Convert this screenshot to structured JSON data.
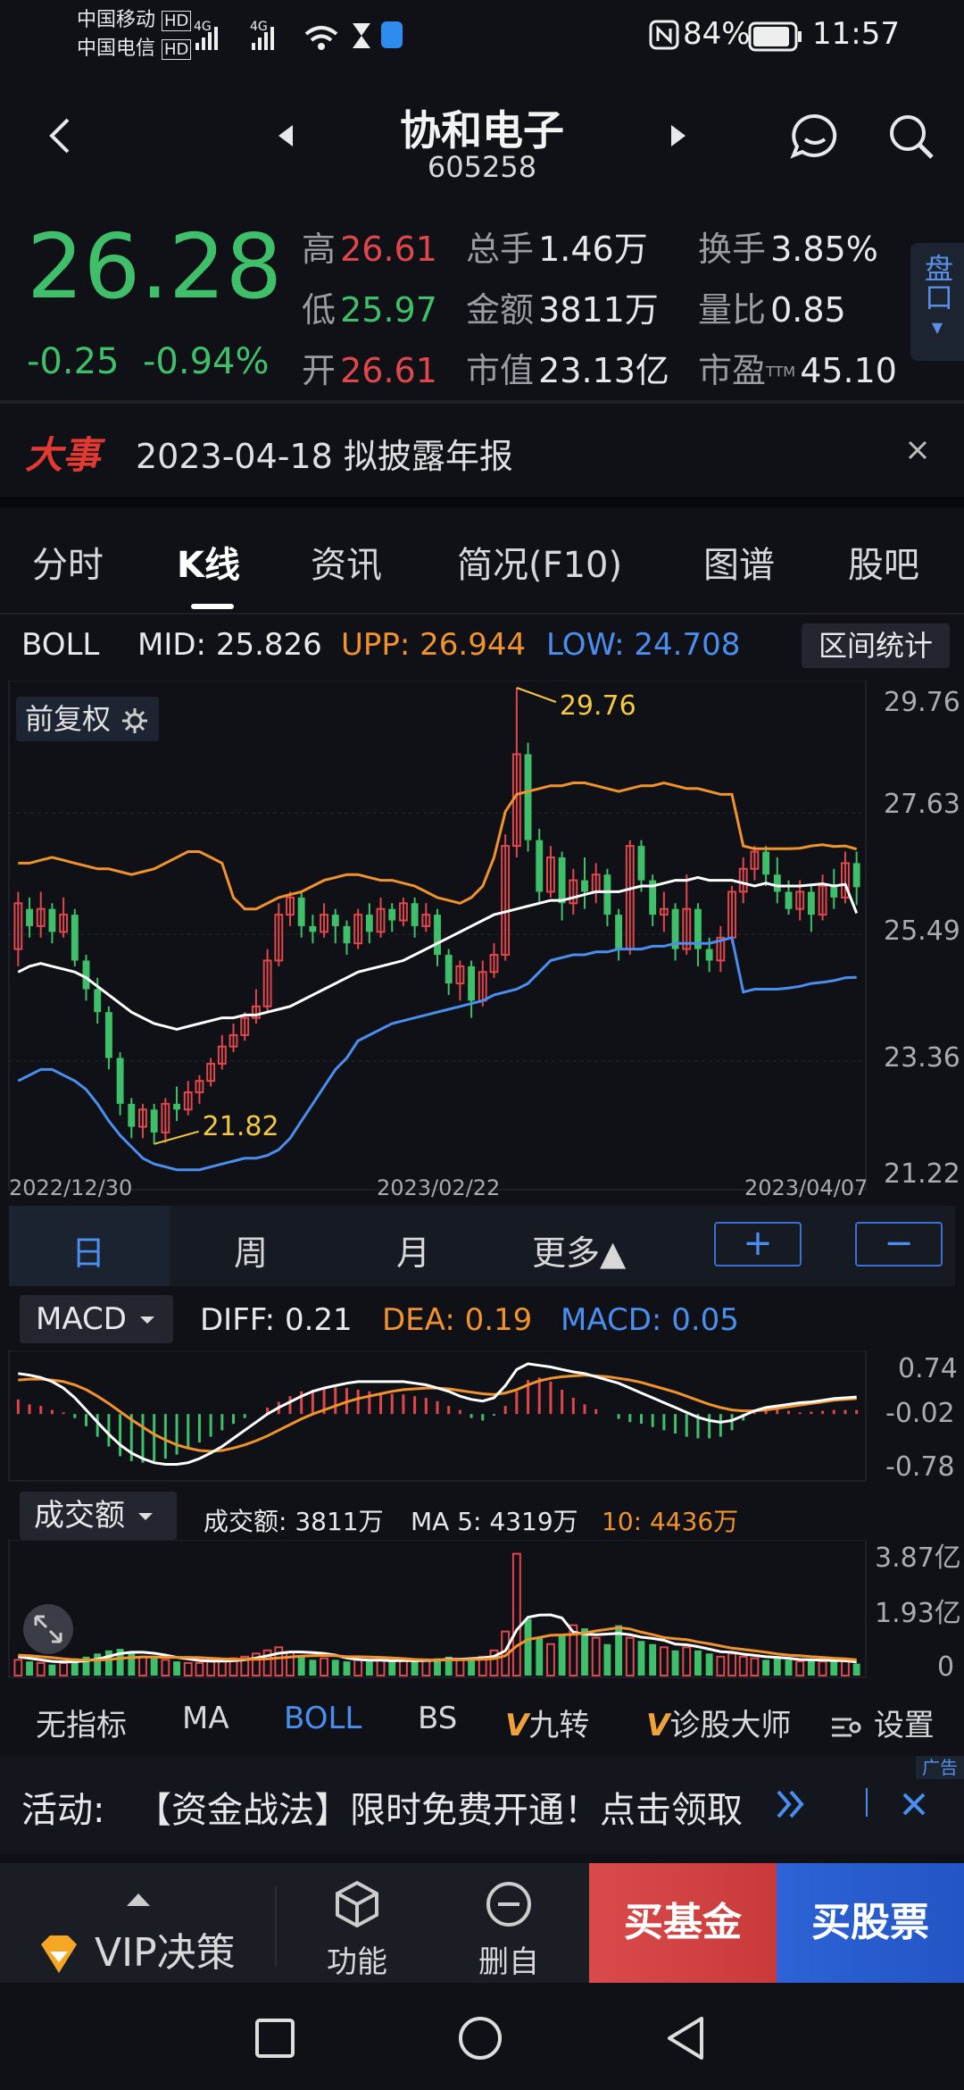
{
  "status_bar": {
    "carrier1": "中国移动",
    "carrier2": "中国电信",
    "hd": "HD",
    "signal_4g": "4G",
    "battery": "84%",
    "time": "11:57"
  },
  "header": {
    "title": "协和电子",
    "code": "605258"
  },
  "quote": {
    "price": "26.28",
    "change": "-0.25",
    "change_pct": "-0.94%",
    "high_label": "高",
    "high": "26.61",
    "low_label": "低",
    "low": "25.97",
    "open_label": "开",
    "open": "26.61",
    "volume_label": "总手",
    "volume": "1.46万",
    "amount_label": "金额",
    "amount": "3811万",
    "mktcap_label": "市值",
    "mktcap": "23.13亿",
    "turnover_label": "换手",
    "turnover": "3.85%",
    "vol_ratio_label": "量比",
    "vol_ratio": "0.85",
    "pe_label": "市盈",
    "pe_sup": "TTM",
    "pe": "45.10",
    "pankou": "盘口"
  },
  "news": {
    "tag": "大事",
    "text": "2023-04-18 拟披露年报"
  },
  "tabs": [
    "分时",
    "K线",
    "资讯",
    "简况(F10)",
    "图谱",
    "股吧"
  ],
  "boll": {
    "name": "BOLL",
    "mid_label": "MID:",
    "mid": "25.826",
    "upp_label": "UPP:",
    "upp": "26.944",
    "low_label": "LOW:",
    "low": "24.708",
    "range_stats": "区间统计",
    "adjust": "前复权"
  },
  "colors": {
    "up": "#e0474c",
    "down": "#3fbf6a",
    "upper_band": "#f0922e",
    "mid_band": "#ffffff",
    "lower_band": "#4a8ff0",
    "label_yellow": "#f5c842"
  },
  "chart_data": [
    {
      "type": "candlestick",
      "title": "",
      "x_labels": [
        "2022/12/30",
        "2023/02/22",
        "2023/04/07"
      ],
      "ylim": [
        21.22,
        29.76
      ],
      "y_ticks": [
        "29.76",
        "27.63",
        "25.49",
        "23.36",
        "21.22"
      ],
      "annotations": [
        {
          "label": "29.76",
          "value": 29.76
        },
        {
          "label": "21.82",
          "value": 21.82
        }
      ],
      "candles": [
        [
          25.2,
          26.0,
          24.9,
          26.2
        ],
        [
          25.9,
          25.6,
          25.4,
          26.1
        ],
        [
          25.6,
          25.9,
          25.4,
          26.2
        ],
        [
          25.9,
          25.5,
          25.3,
          26.0
        ],
        [
          25.5,
          25.8,
          25.4,
          26.1
        ],
        [
          25.8,
          25.0,
          24.9,
          25.9
        ],
        [
          25.0,
          24.5,
          24.3,
          25.1
        ],
        [
          24.5,
          24.1,
          23.9,
          24.7
        ],
        [
          24.1,
          23.3,
          23.1,
          24.2
        ],
        [
          23.3,
          22.5,
          22.3,
          23.4
        ],
        [
          22.5,
          22.1,
          21.9,
          22.6
        ],
        [
          22.1,
          22.4,
          21.9,
          22.5
        ],
        [
          22.4,
          22.0,
          21.8,
          22.5
        ],
        [
          22.0,
          22.5,
          21.82,
          22.6
        ],
        [
          22.5,
          22.4,
          22.2,
          22.8
        ],
        [
          22.4,
          22.7,
          22.3,
          22.9
        ],
        [
          22.7,
          22.9,
          22.5,
          23.0
        ],
        [
          22.9,
          23.2,
          22.8,
          23.3
        ],
        [
          23.2,
          23.5,
          23.1,
          23.7
        ],
        [
          23.5,
          23.7,
          23.4,
          23.9
        ],
        [
          23.7,
          24.0,
          23.6,
          24.1
        ],
        [
          24.0,
          24.2,
          23.9,
          24.5
        ],
        [
          24.2,
          25.0,
          24.1,
          25.2
        ],
        [
          25.0,
          25.8,
          24.9,
          26.0
        ],
        [
          25.8,
          26.1,
          25.6,
          26.2
        ],
        [
          26.1,
          25.6,
          25.4,
          26.2
        ],
        [
          25.6,
          25.5,
          25.3,
          25.8
        ],
        [
          25.5,
          25.8,
          25.4,
          26.0
        ],
        [
          25.8,
          25.6,
          25.3,
          25.9
        ],
        [
          25.6,
          25.3,
          25.1,
          25.7
        ],
        [
          25.3,
          25.8,
          25.2,
          25.9
        ],
        [
          25.8,
          25.5,
          25.3,
          26.0
        ],
        [
          25.5,
          25.9,
          25.4,
          26.1
        ],
        [
          25.9,
          25.7,
          25.5,
          26.0
        ],
        [
          25.7,
          26.0,
          25.6,
          26.1
        ],
        [
          26.0,
          25.6,
          25.4,
          26.1
        ],
        [
          25.6,
          25.8,
          25.5,
          26.0
        ],
        [
          25.8,
          25.1,
          24.9,
          25.9
        ],
        [
          25.1,
          24.6,
          24.4,
          25.2
        ],
        [
          24.6,
          24.9,
          24.3,
          25.0
        ],
        [
          24.9,
          24.3,
          24.0,
          25.0
        ],
        [
          24.3,
          24.8,
          24.2,
          25.0
        ],
        [
          24.8,
          25.1,
          24.7,
          25.3
        ],
        [
          25.1,
          27.0,
          25.0,
          27.2
        ],
        [
          27.0,
          28.6,
          26.8,
          29.76
        ],
        [
          28.6,
          27.1,
          26.9,
          28.8
        ],
        [
          27.1,
          26.2,
          26.0,
          27.3
        ],
        [
          26.2,
          26.8,
          26.1,
          27.0
        ],
        [
          26.8,
          26.0,
          25.7,
          26.9
        ],
        [
          26.0,
          26.4,
          25.8,
          26.6
        ],
        [
          26.4,
          26.2,
          25.9,
          26.8
        ],
        [
          26.2,
          26.5,
          26.0,
          26.7
        ],
        [
          26.5,
          25.8,
          25.6,
          26.6
        ],
        [
          25.8,
          25.2,
          25.0,
          25.9
        ],
        [
          25.2,
          27.0,
          25.1,
          27.1
        ],
        [
          27.0,
          26.4,
          26.2,
          27.1
        ],
        [
          26.4,
          25.8,
          25.6,
          26.5
        ],
        [
          25.8,
          25.9,
          25.5,
          26.2
        ],
        [
          25.9,
          25.2,
          25.0,
          26.0
        ],
        [
          25.2,
          25.9,
          25.1,
          26.5
        ],
        [
          25.9,
          25.2,
          24.9,
          26.0
        ],
        [
          25.2,
          25.0,
          24.8,
          25.4
        ],
        [
          25.0,
          25.4,
          24.8,
          25.6
        ],
        [
          25.4,
          26.2,
          25.3,
          26.3
        ],
        [
          26.2,
          26.6,
          26.0,
          26.8
        ],
        [
          26.6,
          26.9,
          26.4,
          27.0
        ],
        [
          26.9,
          26.5,
          26.3,
          27.0
        ],
        [
          26.5,
          26.2,
          26.0,
          26.8
        ],
        [
          26.2,
          25.9,
          25.8,
          26.4
        ],
        [
          25.9,
          26.2,
          25.7,
          26.4
        ],
        [
          26.2,
          25.8,
          25.5,
          26.3
        ],
        [
          25.8,
          26.3,
          25.7,
          26.5
        ],
        [
          26.3,
          26.1,
          25.9,
          26.6
        ],
        [
          26.1,
          26.7,
          26.0,
          26.9
        ],
        [
          26.7,
          26.28,
          25.97,
          26.9
        ]
      ],
      "upper": [
        26.7,
        26.7,
        26.75,
        26.8,
        26.75,
        26.7,
        26.65,
        26.6,
        26.6,
        26.55,
        26.5,
        26.55,
        26.6,
        26.7,
        26.8,
        26.9,
        26.9,
        26.8,
        26.7,
        26.1,
        25.9,
        25.9,
        26.0,
        26.1,
        26.15,
        26.2,
        26.3,
        26.4,
        26.45,
        26.5,
        26.5,
        26.45,
        26.4,
        26.4,
        26.35,
        26.3,
        26.2,
        26.1,
        26.05,
        26.0,
        26.1,
        26.3,
        26.8,
        27.6,
        27.9,
        27.95,
        28.0,
        28.05,
        28.05,
        28.1,
        28.1,
        28.05,
        28.0,
        27.95,
        28.0,
        28.05,
        28.05,
        28.1,
        28.05,
        28.0,
        28.0,
        27.95,
        27.9,
        27.9,
        27.0,
        26.95,
        26.95,
        26.95,
        26.95,
        26.96,
        27.0,
        27.02,
        26.99,
        27.0,
        26.944
      ],
      "mid": [
        24.8,
        24.9,
        24.95,
        24.9,
        24.85,
        24.8,
        24.7,
        24.55,
        24.4,
        24.25,
        24.1,
        24.0,
        23.9,
        23.85,
        23.8,
        23.85,
        23.9,
        23.95,
        24.0,
        24.0,
        24.05,
        24.05,
        24.1,
        24.15,
        24.2,
        24.3,
        24.4,
        24.5,
        24.6,
        24.7,
        24.8,
        24.85,
        24.9,
        24.95,
        25.0,
        25.1,
        25.2,
        25.3,
        25.4,
        25.5,
        25.6,
        25.7,
        25.8,
        25.85,
        25.9,
        25.95,
        26.0,
        26.05,
        26.05,
        26.1,
        26.15,
        26.2,
        26.2,
        26.2,
        26.25,
        26.3,
        26.3,
        26.35,
        26.4,
        26.4,
        26.45,
        26.4,
        26.4,
        26.4,
        26.35,
        26.3,
        26.35,
        26.3,
        26.3,
        26.3,
        26.32,
        26.34,
        26.3,
        26.33,
        25.826
      ],
      "lower": [
        22.9,
        23.0,
        23.1,
        23.1,
        23.0,
        22.9,
        22.75,
        22.5,
        22.2,
        21.95,
        21.75,
        21.55,
        21.45,
        21.4,
        21.35,
        21.35,
        21.35,
        21.4,
        21.45,
        21.5,
        21.55,
        21.55,
        21.6,
        21.7,
        21.9,
        22.2,
        22.5,
        22.8,
        23.1,
        23.3,
        23.6,
        23.7,
        23.8,
        23.9,
        23.95,
        24.0,
        24.05,
        24.1,
        24.15,
        24.2,
        24.25,
        24.3,
        24.4,
        24.45,
        24.5,
        24.6,
        24.8,
        25.0,
        25.05,
        25.1,
        25.1,
        25.15,
        25.15,
        25.2,
        25.2,
        25.2,
        25.25,
        25.25,
        25.3,
        25.3,
        25.3,
        25.3,
        25.35,
        25.4,
        24.45,
        24.5,
        24.5,
        24.5,
        24.52,
        24.55,
        24.6,
        24.62,
        24.65,
        24.7,
        24.708
      ]
    },
    {
      "type": "bar",
      "title": "MACD",
      "ylim": [
        -0.78,
        0.74
      ],
      "y_ticks": [
        "0.74",
        "-0.02",
        "-0.78"
      ],
      "hist": [
        0.18,
        0.12,
        0.1,
        0.05,
        0.02,
        -0.05,
        -0.15,
        -0.28,
        -0.4,
        -0.52,
        -0.58,
        -0.6,
        -0.58,
        -0.55,
        -0.5,
        -0.42,
        -0.35,
        -0.28,
        -0.2,
        -0.12,
        -0.05,
        0.0,
        0.08,
        0.15,
        0.22,
        0.28,
        0.3,
        0.32,
        0.33,
        0.32,
        0.3,
        0.28,
        0.26,
        0.25,
        0.24,
        0.22,
        0.2,
        0.16,
        0.1,
        0.05,
        -0.05,
        -0.08,
        -0.02,
        0.1,
        0.28,
        0.42,
        0.45,
        0.4,
        0.3,
        0.2,
        0.12,
        0.06,
        0.0,
        -0.06,
        -0.1,
        -0.12,
        -0.16,
        -0.2,
        -0.24,
        -0.28,
        -0.3,
        -0.3,
        -0.28,
        -0.2,
        -0.08,
        0.02,
        0.08,
        0.06,
        0.04,
        0.02,
        0.03,
        0.04,
        0.05,
        0.05,
        0.05
      ],
      "diff": [
        0.5,
        0.48,
        0.45,
        0.4,
        0.32,
        0.2,
        0.05,
        -0.1,
        -0.25,
        -0.38,
        -0.48,
        -0.55,
        -0.6,
        -0.62,
        -0.62,
        -0.6,
        -0.55,
        -0.48,
        -0.4,
        -0.3,
        -0.2,
        -0.1,
        0.0,
        0.08,
        0.15,
        0.22,
        0.28,
        0.32,
        0.35,
        0.38,
        0.4,
        0.4,
        0.4,
        0.4,
        0.4,
        0.38,
        0.36,
        0.32,
        0.28,
        0.22,
        0.18,
        0.16,
        0.2,
        0.35,
        0.55,
        0.62,
        0.6,
        0.58,
        0.55,
        0.52,
        0.5,
        0.46,
        0.42,
        0.38,
        0.32,
        0.26,
        0.2,
        0.14,
        0.08,
        0.02,
        -0.04,
        -0.08,
        -0.1,
        -0.08,
        -0.02,
        0.04,
        0.08,
        0.1,
        0.12,
        0.14,
        0.15,
        0.17,
        0.19,
        0.2,
        0.21
      ],
      "dea": [
        0.42,
        0.43,
        0.43,
        0.42,
        0.4,
        0.36,
        0.3,
        0.22,
        0.13,
        0.03,
        -0.07,
        -0.16,
        -0.25,
        -0.32,
        -0.38,
        -0.42,
        -0.45,
        -0.46,
        -0.45,
        -0.42,
        -0.38,
        -0.33,
        -0.27,
        -0.2,
        -0.13,
        -0.06,
        0.0,
        0.05,
        0.1,
        0.15,
        0.19,
        0.22,
        0.25,
        0.28,
        0.3,
        0.31,
        0.32,
        0.32,
        0.31,
        0.29,
        0.27,
        0.25,
        0.24,
        0.26,
        0.3,
        0.36,
        0.41,
        0.44,
        0.46,
        0.47,
        0.48,
        0.47,
        0.46,
        0.44,
        0.42,
        0.39,
        0.35,
        0.31,
        0.27,
        0.22,
        0.17,
        0.12,
        0.08,
        0.05,
        0.04,
        0.04,
        0.05,
        0.07,
        0.09,
        0.11,
        0.13,
        0.15,
        0.17,
        0.18,
        0.19
      ]
    },
    {
      "type": "bar",
      "title": "成交额",
      "ylim": [
        0,
        4.2
      ],
      "y_ticks": [
        "3.87亿",
        "1.93亿",
        "0"
      ],
      "values": [
        0.5,
        0.45,
        0.4,
        0.35,
        0.4,
        0.55,
        0.6,
        0.7,
        0.8,
        0.85,
        0.75,
        0.6,
        0.55,
        0.5,
        0.45,
        0.4,
        0.4,
        0.45,
        0.5,
        0.55,
        0.6,
        0.7,
        0.8,
        0.9,
        0.75,
        0.6,
        0.5,
        0.55,
        0.5,
        0.45,
        0.5,
        0.45,
        0.5,
        0.45,
        0.5,
        0.45,
        0.5,
        0.55,
        0.6,
        0.5,
        0.55,
        0.6,
        0.8,
        1.4,
        3.87,
        1.8,
        1.2,
        1.0,
        1.3,
        1.6,
        1.5,
        1.2,
        1.0,
        1.6,
        1.2,
        1.1,
        1.0,
        0.9,
        0.8,
        0.9,
        0.8,
        0.7,
        0.6,
        0.7,
        0.6,
        0.55,
        0.5,
        0.55,
        0.5,
        0.45,
        0.5,
        0.45,
        0.5,
        0.45,
        0.38
      ],
      "ma5": [
        0.6,
        0.55,
        0.5,
        0.45,
        0.43,
        0.44,
        0.47,
        0.52,
        0.61,
        0.7,
        0.74,
        0.74,
        0.71,
        0.65,
        0.58,
        0.53,
        0.48,
        0.46,
        0.46,
        0.47,
        0.5,
        0.56,
        0.63,
        0.71,
        0.75,
        0.75,
        0.73,
        0.7,
        0.65,
        0.56,
        0.51,
        0.49,
        0.49,
        0.47,
        0.48,
        0.47,
        0.48,
        0.49,
        0.52,
        0.52,
        0.54,
        0.56,
        0.61,
        0.79,
        1.45,
        1.85,
        1.92,
        1.93,
        1.83,
        1.38,
        1.32,
        1.3,
        1.32,
        1.34,
        1.3,
        1.22,
        1.18,
        1.12,
        1.0,
        0.98,
        0.92,
        0.84,
        0.76,
        0.74,
        0.68,
        0.64,
        0.6,
        0.58,
        0.55,
        0.51,
        0.5,
        0.49,
        0.48,
        0.47,
        0.43
      ],
      "ma10": [
        0.65,
        0.63,
        0.6,
        0.57,
        0.53,
        0.5,
        0.49,
        0.49,
        0.51,
        0.55,
        0.57,
        0.59,
        0.59,
        0.58,
        0.58,
        0.58,
        0.57,
        0.55,
        0.53,
        0.52,
        0.52,
        0.52,
        0.53,
        0.56,
        0.59,
        0.62,
        0.63,
        0.64,
        0.63,
        0.6,
        0.6,
        0.59,
        0.58,
        0.56,
        0.54,
        0.51,
        0.5,
        0.49,
        0.5,
        0.5,
        0.51,
        0.52,
        0.54,
        0.63,
        0.94,
        1.15,
        1.21,
        1.28,
        1.29,
        1.31,
        1.35,
        1.42,
        1.47,
        1.52,
        1.48,
        1.38,
        1.3,
        1.21,
        1.17,
        1.14,
        1.07,
        1.01,
        0.94,
        0.87,
        0.83,
        0.79,
        0.74,
        0.69,
        0.65,
        0.63,
        0.6,
        0.58,
        0.55,
        0.53,
        0.5
      ]
    }
  ],
  "chart_labels": {
    "hi_label": "29.76",
    "lo_label": "21.82",
    "x1": "2022/12/30",
    "x2": "2023/02/22",
    "x3": "2023/04/07",
    "y1": "29.76",
    "y2": "27.63",
    "y3": "25.49",
    "y4": "23.36",
    "y5": "21.22"
  },
  "periods": {
    "day": "日",
    "week": "周",
    "month": "月",
    "more": "更多▲",
    "plus": "+",
    "minus": "−"
  },
  "macd": {
    "selector": "MACD",
    "diff_label": "DIFF:",
    "diff": "0.21",
    "dea_label": "DEA:",
    "dea": "0.19",
    "macd_label": "MACD:",
    "macd": "0.05",
    "y1": "0.74",
    "y2": "-0.02",
    "y3": "-0.78"
  },
  "volume": {
    "selector": "成交额",
    "amt_label": "成交额:",
    "amt": "3811万",
    "ma5_label": "MA 5:",
    "ma5": "4319万",
    "ma10_label": "10:",
    "ma10": "4436万",
    "y1": "3.87亿",
    "y2": "1.93亿",
    "y3": "0"
  },
  "indicators": [
    "无指标",
    "MA",
    "BOLL",
    "BS",
    "九转",
    "诊股大师",
    "设置"
  ],
  "indicator_v": "V",
  "ad": {
    "label": "活动:",
    "text": "【资金战法】限时免费开通！点击领取",
    "tag": "广告"
  },
  "bottom_nav": {
    "vip": "VIP决策",
    "func": "功能",
    "remove": "删自选",
    "buy_fund": "买基金",
    "buy_stock": "买股票"
  }
}
